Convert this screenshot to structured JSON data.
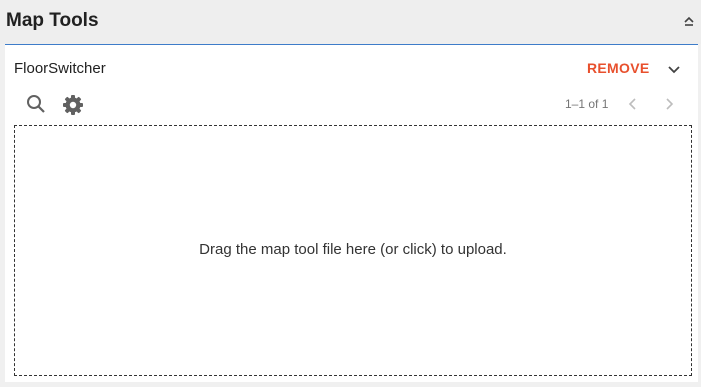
{
  "panel": {
    "title": "Map Tools",
    "collapse_icon": "chevron-up-icon"
  },
  "colors": {
    "accent_rule": "#3d7cc9",
    "remove": "#e8502d",
    "header_bg": "#eeeeee"
  },
  "tool": {
    "name": "FloorSwitcher",
    "remove_label": "REMOVE",
    "expand_icon": "chevron-down-icon"
  },
  "toolbar": {
    "search_icon": "search-icon",
    "settings_icon": "gear-icon",
    "pagination": "1–1 of 1",
    "prev_icon": "chevron-left-icon",
    "next_icon": "chevron-right-icon"
  },
  "dropzone": {
    "text": "Drag the map tool file here (or click) to upload."
  }
}
